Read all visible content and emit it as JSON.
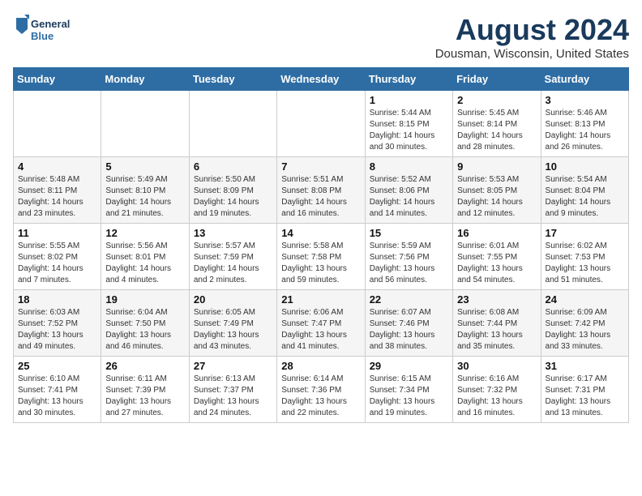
{
  "header": {
    "logo_line1": "General",
    "logo_line2": "Blue",
    "main_title": "August 2024",
    "subtitle": "Dousman, Wisconsin, United States"
  },
  "days_of_week": [
    "Sunday",
    "Monday",
    "Tuesday",
    "Wednesday",
    "Thursday",
    "Friday",
    "Saturday"
  ],
  "weeks": [
    [
      {
        "day": "",
        "info": ""
      },
      {
        "day": "",
        "info": ""
      },
      {
        "day": "",
        "info": ""
      },
      {
        "day": "",
        "info": ""
      },
      {
        "day": "1",
        "info": "Sunrise: 5:44 AM\nSunset: 8:15 PM\nDaylight: 14 hours\nand 30 minutes."
      },
      {
        "day": "2",
        "info": "Sunrise: 5:45 AM\nSunset: 8:14 PM\nDaylight: 14 hours\nand 28 minutes."
      },
      {
        "day": "3",
        "info": "Sunrise: 5:46 AM\nSunset: 8:13 PM\nDaylight: 14 hours\nand 26 minutes."
      }
    ],
    [
      {
        "day": "4",
        "info": "Sunrise: 5:48 AM\nSunset: 8:11 PM\nDaylight: 14 hours\nand 23 minutes."
      },
      {
        "day": "5",
        "info": "Sunrise: 5:49 AM\nSunset: 8:10 PM\nDaylight: 14 hours\nand 21 minutes."
      },
      {
        "day": "6",
        "info": "Sunrise: 5:50 AM\nSunset: 8:09 PM\nDaylight: 14 hours\nand 19 minutes."
      },
      {
        "day": "7",
        "info": "Sunrise: 5:51 AM\nSunset: 8:08 PM\nDaylight: 14 hours\nand 16 minutes."
      },
      {
        "day": "8",
        "info": "Sunrise: 5:52 AM\nSunset: 8:06 PM\nDaylight: 14 hours\nand 14 minutes."
      },
      {
        "day": "9",
        "info": "Sunrise: 5:53 AM\nSunset: 8:05 PM\nDaylight: 14 hours\nand 12 minutes."
      },
      {
        "day": "10",
        "info": "Sunrise: 5:54 AM\nSunset: 8:04 PM\nDaylight: 14 hours\nand 9 minutes."
      }
    ],
    [
      {
        "day": "11",
        "info": "Sunrise: 5:55 AM\nSunset: 8:02 PM\nDaylight: 14 hours\nand 7 minutes."
      },
      {
        "day": "12",
        "info": "Sunrise: 5:56 AM\nSunset: 8:01 PM\nDaylight: 14 hours\nand 4 minutes."
      },
      {
        "day": "13",
        "info": "Sunrise: 5:57 AM\nSunset: 7:59 PM\nDaylight: 14 hours\nand 2 minutes."
      },
      {
        "day": "14",
        "info": "Sunrise: 5:58 AM\nSunset: 7:58 PM\nDaylight: 13 hours\nand 59 minutes."
      },
      {
        "day": "15",
        "info": "Sunrise: 5:59 AM\nSunset: 7:56 PM\nDaylight: 13 hours\nand 56 minutes."
      },
      {
        "day": "16",
        "info": "Sunrise: 6:01 AM\nSunset: 7:55 PM\nDaylight: 13 hours\nand 54 minutes."
      },
      {
        "day": "17",
        "info": "Sunrise: 6:02 AM\nSunset: 7:53 PM\nDaylight: 13 hours\nand 51 minutes."
      }
    ],
    [
      {
        "day": "18",
        "info": "Sunrise: 6:03 AM\nSunset: 7:52 PM\nDaylight: 13 hours\nand 49 minutes."
      },
      {
        "day": "19",
        "info": "Sunrise: 6:04 AM\nSunset: 7:50 PM\nDaylight: 13 hours\nand 46 minutes."
      },
      {
        "day": "20",
        "info": "Sunrise: 6:05 AM\nSunset: 7:49 PM\nDaylight: 13 hours\nand 43 minutes."
      },
      {
        "day": "21",
        "info": "Sunrise: 6:06 AM\nSunset: 7:47 PM\nDaylight: 13 hours\nand 41 minutes."
      },
      {
        "day": "22",
        "info": "Sunrise: 6:07 AM\nSunset: 7:46 PM\nDaylight: 13 hours\nand 38 minutes."
      },
      {
        "day": "23",
        "info": "Sunrise: 6:08 AM\nSunset: 7:44 PM\nDaylight: 13 hours\nand 35 minutes."
      },
      {
        "day": "24",
        "info": "Sunrise: 6:09 AM\nSunset: 7:42 PM\nDaylight: 13 hours\nand 33 minutes."
      }
    ],
    [
      {
        "day": "25",
        "info": "Sunrise: 6:10 AM\nSunset: 7:41 PM\nDaylight: 13 hours\nand 30 minutes."
      },
      {
        "day": "26",
        "info": "Sunrise: 6:11 AM\nSunset: 7:39 PM\nDaylight: 13 hours\nand 27 minutes."
      },
      {
        "day": "27",
        "info": "Sunrise: 6:13 AM\nSunset: 7:37 PM\nDaylight: 13 hours\nand 24 minutes."
      },
      {
        "day": "28",
        "info": "Sunrise: 6:14 AM\nSunset: 7:36 PM\nDaylight: 13 hours\nand 22 minutes."
      },
      {
        "day": "29",
        "info": "Sunrise: 6:15 AM\nSunset: 7:34 PM\nDaylight: 13 hours\nand 19 minutes."
      },
      {
        "day": "30",
        "info": "Sunrise: 6:16 AM\nSunset: 7:32 PM\nDaylight: 13 hours\nand 16 minutes."
      },
      {
        "day": "31",
        "info": "Sunrise: 6:17 AM\nSunset: 7:31 PM\nDaylight: 13 hours\nand 13 minutes."
      }
    ]
  ]
}
